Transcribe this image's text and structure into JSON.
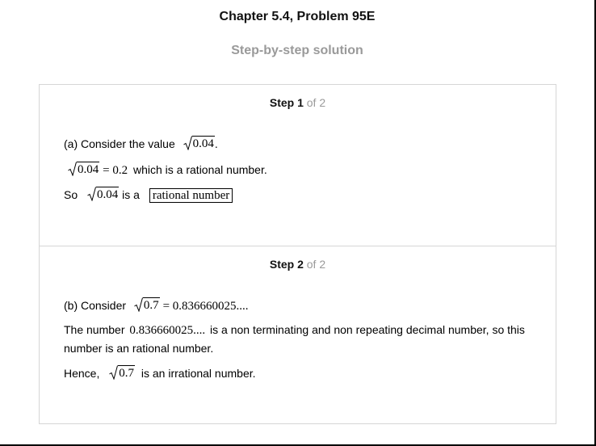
{
  "header": {
    "title": "Chapter 5.4, Problem 95E",
    "subtitle": "Step-by-step solution"
  },
  "steps": [
    {
      "label": "Step 1",
      "of": "of 2",
      "l1_text": "(a) Consider the value",
      "l1_radicand": "0.04",
      "l1_end": ".",
      "l2_radicand": "0.04",
      "l2_eq": "= 0.2",
      "l2_text": "which is a rational number.",
      "l3_so": "So",
      "l3_radicand": "0.04",
      "l3_isa": "is a",
      "l3_boxed": "rational number"
    },
    {
      "label": "Step 2",
      "of": "of 2",
      "l1_text": "(b) Consider",
      "l1_radicand": "0.7",
      "l1_eq": "= 0.836660025....",
      "l2_pre": "The number",
      "l2_math": "0.836660025....",
      "l2_post": "is a non terminating and non repeating decimal number, so this number is an rational number.",
      "l3_pre": "Hence,",
      "l3_radicand": "0.7",
      "l3_post": "is an irrational number."
    }
  ]
}
